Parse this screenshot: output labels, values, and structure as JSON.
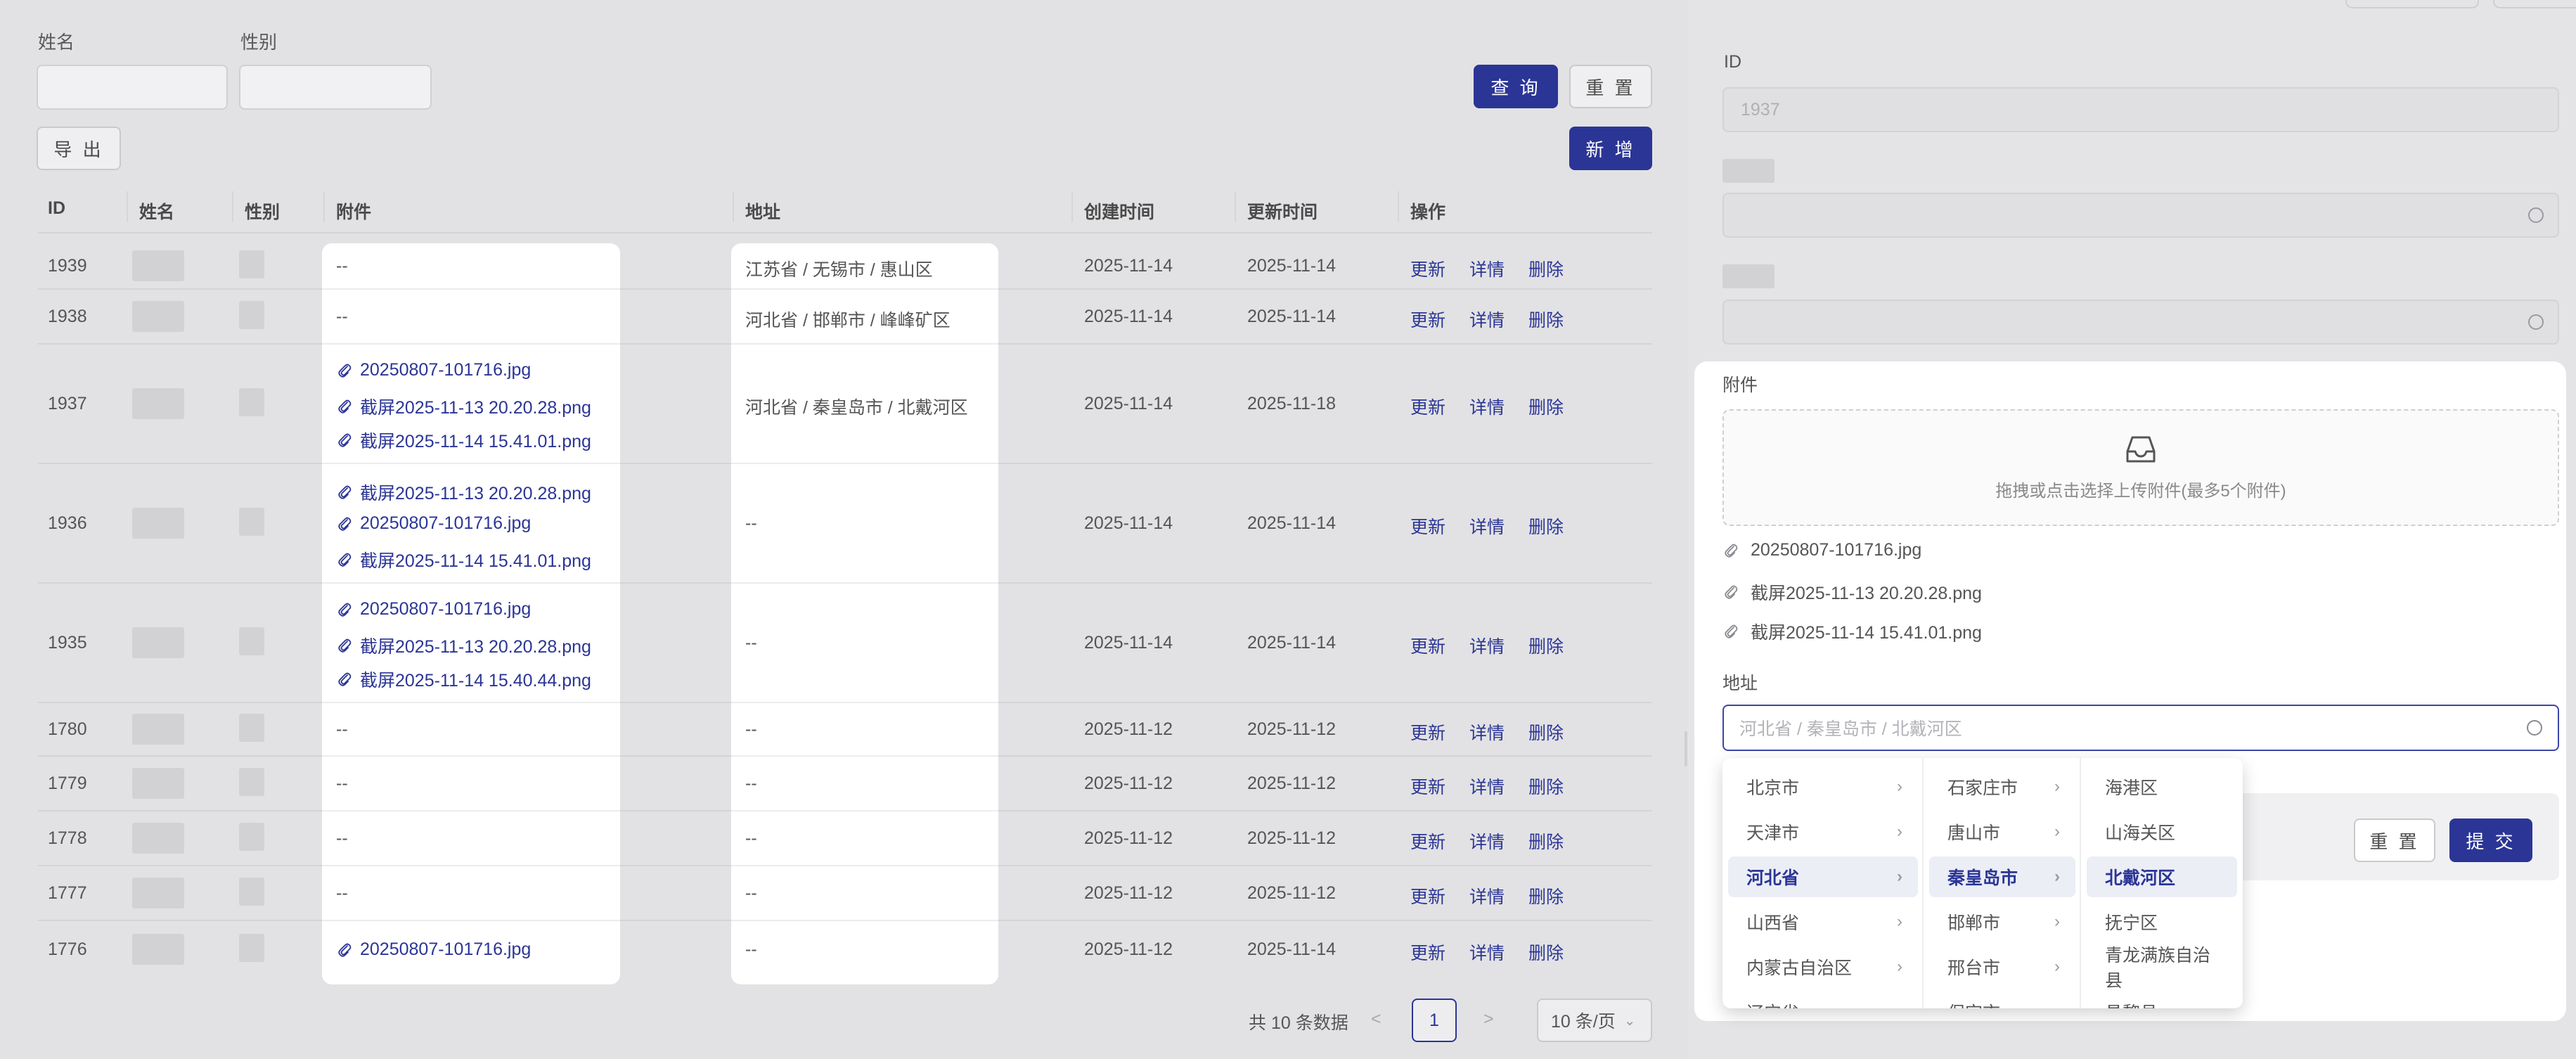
{
  "filters": {
    "name_label": "姓名",
    "gender_label": "性别",
    "query_label": "查 询",
    "reset_label": "重 置",
    "export_label": "导 出",
    "add_label": "新 增"
  },
  "table": {
    "headers": [
      "ID",
      "姓名",
      "性别",
      "附件",
      "地址",
      "创建时间",
      "更新时间",
      "操作"
    ],
    "ops": [
      "更新",
      "详情",
      "删除"
    ],
    "rows": [
      {
        "id": "1939",
        "attachments": [],
        "address": "江苏省 / 无锡市 / 惠山区",
        "created": "2025-11-14",
        "updated": "2025-11-14"
      },
      {
        "id": "1938",
        "attachments": [],
        "address": "河北省 / 邯郸市 / 峰峰矿区",
        "created": "2025-11-14",
        "updated": "2025-11-14"
      },
      {
        "id": "1937",
        "attachments": [
          "20250807-101716.jpg",
          "截屏2025-11-13 20.20.28.png",
          "截屏2025-11-14 15.41.01.png"
        ],
        "address": "河北省 / 秦皇岛市 / 北戴河区",
        "created": "2025-11-14",
        "updated": "2025-11-18"
      },
      {
        "id": "1936",
        "attachments": [
          "截屏2025-11-13 20.20.28.png",
          "20250807-101716.jpg",
          "截屏2025-11-14 15.41.01.png"
        ],
        "address": "--",
        "created": "2025-11-14",
        "updated": "2025-11-14"
      },
      {
        "id": "1935",
        "attachments": [
          "20250807-101716.jpg",
          "截屏2025-11-13 20.20.28.png",
          "截屏2025-11-14 15.40.44.png"
        ],
        "address": "--",
        "created": "2025-11-14",
        "updated": "2025-11-14"
      },
      {
        "id": "1780",
        "attachments": [],
        "address": "--",
        "created": "2025-11-12",
        "updated": "2025-11-12"
      },
      {
        "id": "1779",
        "attachments": [],
        "address": "--",
        "created": "2025-11-12",
        "updated": "2025-11-12"
      },
      {
        "id": "1778",
        "attachments": [],
        "address": "--",
        "created": "2025-11-12",
        "updated": "2025-11-12"
      },
      {
        "id": "1777",
        "attachments": [],
        "address": "--",
        "created": "2025-11-12",
        "updated": "2025-11-12"
      },
      {
        "id": "1776",
        "attachments": [
          "20250807-101716.jpg"
        ],
        "address": "--",
        "created": "2025-11-12",
        "updated": "2025-11-14"
      }
    ],
    "empty": "--"
  },
  "pagination": {
    "total_text": "共 10 条数据",
    "prev": "<",
    "next": ">",
    "current_page": "1",
    "page_size": "10 条/页"
  },
  "drawer": {
    "id_label": "ID",
    "id_value": "1937",
    "attachments_label": "附件",
    "upload_hint": "拖拽或点击选择上传附件(最多5个附件)",
    "files": [
      "20250807-101716.jpg",
      "截屏2025-11-13 20.20.28.png",
      "截屏2025-11-14 15.41.01.png"
    ],
    "address_label": "地址",
    "address_placeholder": "河北省 / 秦皇岛市 / 北戴河区",
    "reset_label": "重 置",
    "submit_label": "提 交"
  },
  "cascader": {
    "provinces": [
      "北京市",
      "天津市",
      "河北省",
      "山西省",
      "内蒙古自治区",
      "辽宁省"
    ],
    "cities": [
      "石家庄市",
      "唐山市",
      "秦皇岛市",
      "邯郸市",
      "邢台市",
      "保定市"
    ],
    "districts": [
      "海港区",
      "山海关区",
      "北戴河区",
      "抚宁区",
      "青龙满族自治县",
      "昌黎县"
    ],
    "active_province": "河北省",
    "active_city": "秦皇岛市",
    "active_district": "北戴河区"
  },
  "colors": {
    "primary": "#2b3596",
    "overlay_bg": "#e2e2e4"
  }
}
